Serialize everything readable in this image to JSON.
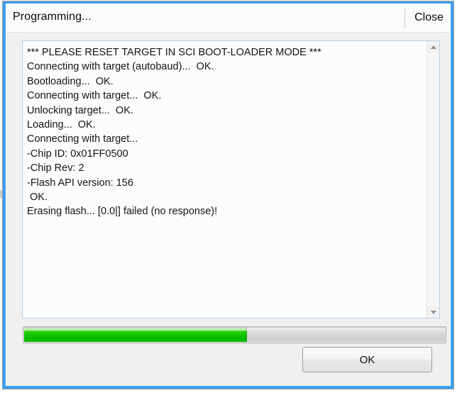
{
  "window": {
    "title": "Programming...",
    "close_label": "Close",
    "frame_color": "#3da0f2",
    "chrome_color": "#f0f0f0"
  },
  "log": {
    "lines": [
      "*** PLEASE RESET TARGET IN SCI BOOT-LOADER MODE ***",
      "Connecting with target (autobaud)...  OK.",
      "Bootloading...  OK.",
      "Connecting with target...  OK.",
      "Unlocking target...  OK.",
      "Loading...  OK.",
      "Connecting with target...",
      "-Chip ID: 0x01FF0500",
      "-Chip Rev: 2",
      "-Flash API version: 156",
      " OK.",
      "Erasing flash... [0.0|] failed (no response)!"
    ],
    "scrollbar": {
      "up_icon": "triangle-up-icon",
      "down_icon": "triangle-down-icon"
    }
  },
  "progress": {
    "percent": 53,
    "percent_css": "53%",
    "fill_color": "#0cc400",
    "track_color": "#d6d6d6"
  },
  "buttons": {
    "ok_label": "OK"
  }
}
